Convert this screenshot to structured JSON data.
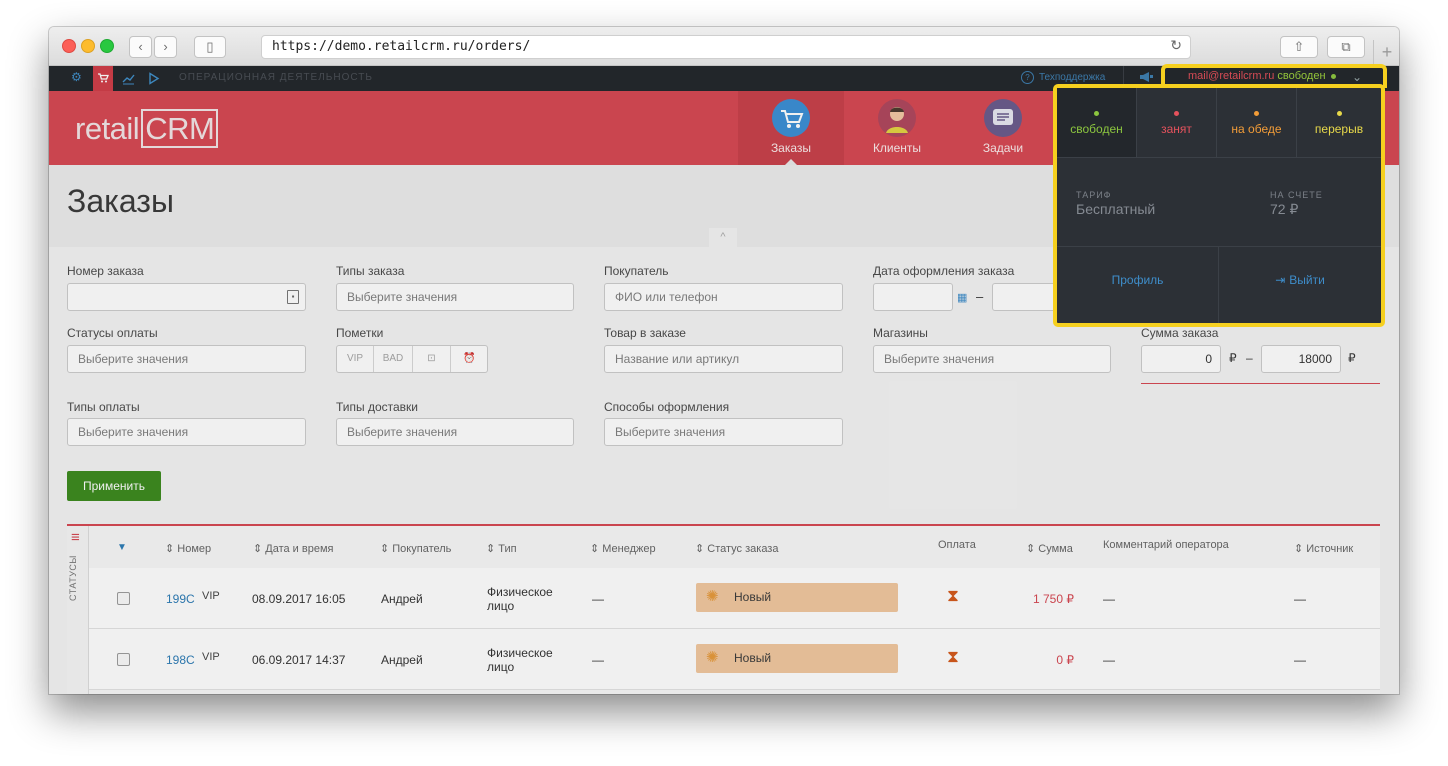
{
  "browser": {
    "url": "https://demo.retailcrm.ru/orders/",
    "back_icon": "‹",
    "forward_icon": "›",
    "sidebar_icon": "▯",
    "reload_icon": "↻",
    "share_icon": "⇧",
    "tabs_icon": "⧉",
    "new_tab_icon": "+"
  },
  "topbar": {
    "section": "ОПЕРАЦИОННАЯ ДЕЯТЕЛЬНОСТЬ",
    "support": "Техподдержка",
    "user_email": "mail@retailcrm.ru",
    "user_status": "свободен",
    "chevron": "⌄",
    "icons": [
      "gear-icon",
      "cart-icon",
      "analytics-icon",
      "play-icon"
    ]
  },
  "header": {
    "logo_prefix": "retail",
    "logo_suffix": "CRM",
    "nav": [
      {
        "label": "Заказы"
      },
      {
        "label": "Клиенты"
      },
      {
        "label": "Задачи"
      }
    ]
  },
  "page": {
    "title": "Заказы",
    "collapse_icon": "^"
  },
  "filters": {
    "order_number": {
      "label": "Номер заказа",
      "value": ""
    },
    "order_types": {
      "label": "Типы заказа",
      "placeholder": "Выберите значения"
    },
    "customer": {
      "label": "Покупатель",
      "placeholder": "ФИО или телефон"
    },
    "order_date": {
      "label": "Дата оформления заказа",
      "separator": "–"
    },
    "payment_statuses": {
      "label": "Статусы оплаты",
      "placeholder": "Выберите значения"
    },
    "marks": {
      "label": "Пометки",
      "tags": [
        "VIP",
        "BAD"
      ]
    },
    "product": {
      "label": "Товар в заказе",
      "placeholder": "Название или артикул"
    },
    "shops": {
      "label": "Магазины",
      "placeholder": "Выберите значения"
    },
    "order_sum": {
      "label": "Сумма заказа",
      "min": "0",
      "max": "18000",
      "currency": "₽",
      "separator": "–"
    },
    "payment_types": {
      "label": "Типы оплаты",
      "placeholder": "Выберите значения"
    },
    "delivery_types": {
      "label": "Типы доставки",
      "placeholder": "Выберите значения"
    },
    "order_methods": {
      "label": "Способы оформления",
      "placeholder": "Выберите значения"
    },
    "apply_label": "Применить"
  },
  "table": {
    "side_label": "СТАТУСЫ",
    "columns": {
      "number": "⇕ Номер",
      "date": "⇕ Дата и время",
      "customer": "⇕ Покупатель",
      "type": "⇕ Тип",
      "manager": "⇕ Менеджер",
      "status": "⇕ Статус заказа",
      "payment": "Оплата",
      "sum": "⇕ Сумма",
      "comment": "Комментарий оператора",
      "source": "⇕ Источник"
    },
    "rows": [
      {
        "number": "199C",
        "mark": "VIP",
        "date": "08.09.2017 16:05",
        "customer": "Андрей",
        "type_line1": "Физическое",
        "type_line2": "лицо",
        "manager": "—",
        "status": "Новый",
        "sum": "1 750 ₽",
        "comment": "—",
        "source": "—"
      },
      {
        "number": "198C",
        "mark": "VIP",
        "date": "06.09.2017 14:37",
        "customer": "Андрей",
        "type_line1": "Физическое",
        "type_line2": "лицо",
        "manager": "—",
        "status": "Новый",
        "sum": "0 ₽",
        "comment": "—",
        "source": "—"
      }
    ]
  },
  "dropdown": {
    "statuses": [
      {
        "label": "свободен",
        "color": "#8cc63f"
      },
      {
        "label": "занят",
        "color": "#e5525d"
      },
      {
        "label": "на обеде",
        "color": "#f29c38"
      },
      {
        "label": "перерыв",
        "color": "#e7d84a"
      }
    ],
    "tariff_label": "ТАРИФ",
    "tariff_value": "Бесплатный",
    "balance_label": "НА СЧЕТЕ",
    "balance_value": "72 ₽",
    "profile_label": "Профиль",
    "logout_label": "Выйти"
  },
  "colors": {
    "brand": "#d74852",
    "highlight": "#f6d01f",
    "apply": "#3c8a1e",
    "status_badge": "#f1c89f"
  }
}
